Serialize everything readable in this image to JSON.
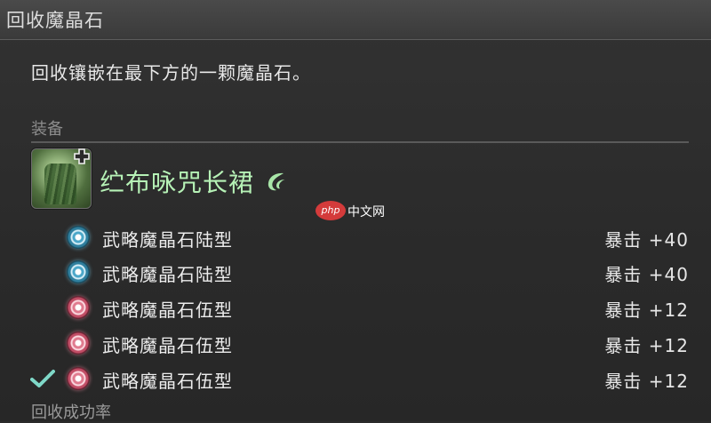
{
  "window": {
    "title": "回收魔晶石"
  },
  "description": "回收镶嵌在最下方的一颗魔晶石。",
  "equipment_section": {
    "label": "装备",
    "item_name": "纻布咏咒长裙"
  },
  "watermark": {
    "logo_text": "php",
    "text": "中文网"
  },
  "materia": [
    {
      "icon": "materia-blue-icon",
      "name": "武略魔晶石陆型",
      "stat": "暴击 +40",
      "selected": false
    },
    {
      "icon": "materia-blue-icon",
      "name": "武略魔晶石陆型",
      "stat": "暴击 +40",
      "selected": false
    },
    {
      "icon": "materia-pink-icon",
      "name": "武略魔晶石伍型",
      "stat": "暴击 +12",
      "selected": false
    },
    {
      "icon": "materia-pink-icon",
      "name": "武略魔晶石伍型",
      "stat": "暴击 +12",
      "selected": false
    },
    {
      "icon": "materia-pink-icon",
      "name": "武略魔晶石伍型",
      "stat": "暴击 +12",
      "selected": true
    }
  ],
  "footer": {
    "success_rate_label": "回收成功率"
  },
  "colors": {
    "item_name": "#b6f2b6",
    "check": "#7fd8c8",
    "materia_blue": "#4aa6c8",
    "materia_pink": "#e07a8e"
  }
}
